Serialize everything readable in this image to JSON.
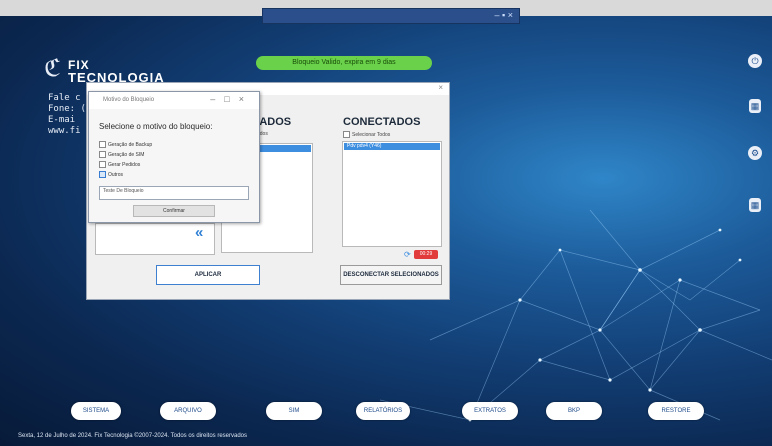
{
  "top_bar": {
    "controls": "– ▪ ×"
  },
  "logo": {
    "line1": "FIX",
    "line2": "TECNOLOGIA"
  },
  "contact": {
    "line1": "Fale c",
    "line2": "Fone: (",
    "line3": "E-mai",
    "line4": "www.fi"
  },
  "license_banner": "Bloqueio Valido, expira em 9 dias",
  "main_panel": {
    "bloqueados_header": "EADOS",
    "bloqueados_sub": "odos",
    "conectados_header": "CONECTADOS",
    "select_all": "Selecionar Todos",
    "connected_item": "Pdv pdv4 (Y46)",
    "timer": "00:29",
    "apply_button": "APLICAR",
    "disconnect_button": "DESCONECTAR SELECIONADOS"
  },
  "dialog": {
    "title": "Motivo do Bloqueio",
    "question": "Selecione o motivo do bloqueio:",
    "options": [
      {
        "label": "Geração de Backup",
        "checked": false
      },
      {
        "label": "Geração de SIM",
        "checked": false
      },
      {
        "label": "Gerar Pedidos",
        "checked": false
      },
      {
        "label": "Outros",
        "checked": true
      }
    ],
    "input_value": "Teste De Bloqueio",
    "confirm_button": "Confirmar"
  },
  "nav_buttons": [
    "SISTEMA",
    "ARQUIVO",
    "SIM",
    "RELATÓRIOS",
    "EXTRATOS",
    "BKP",
    "RESTORE"
  ],
  "footer": "Sexta, 12 de Julho de 2024.   Fix Tecnologia ©2007-2024. Todos os direitos reservados"
}
